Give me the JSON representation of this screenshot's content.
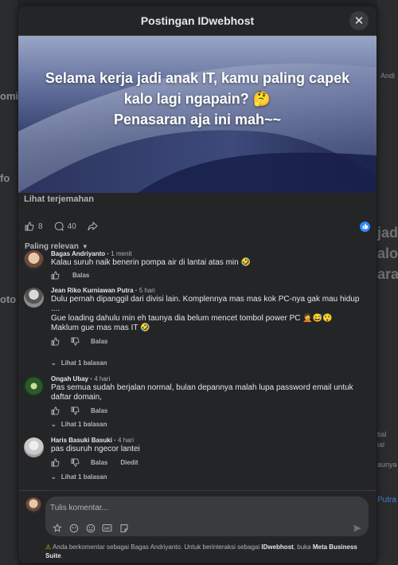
{
  "background": {
    "right_big": [
      "jad",
      "alo",
      "ara"
    ],
    "left_labels": [
      "omi",
      "fo",
      "oto"
    ],
    "right_small": [
      "Andi",
      "tial",
      "ial",
      "aunya",
      "Putra"
    ]
  },
  "post": {
    "header_title": "Postingan IDwebhost",
    "image_text_line1": "Selama kerja jadi anak IT, kamu paling capek",
    "image_text_line2": "kalo lagi ngapain? 🤔",
    "image_text_line3": "Penasaran aja ini mah~~",
    "see_translation": "Lihat terjemahan",
    "like_count": "8",
    "comment_count": "40",
    "sort_label": "Paling relevan"
  },
  "comments": [
    {
      "name": "Bagas Andriyanto",
      "time": "1 menit",
      "text": "Kalau suruh naik benerin pompa air di lantai atas min 🤣",
      "reply_label": "Balas"
    },
    {
      "name": "Jean Riko Kurniawan Putra",
      "time": "5 hari",
      "text1": "Dulu pernah dipanggil dari divisi lain. Komplennya mas mas kok PC-nya gak mau hidup ....",
      "text2": "Gue loading dahulu min eh taunya dia belum mencet tombol power PC 🤦😅😲",
      "text3": "Maklum gue mas mas IT 🤣",
      "reply_label": "Balas",
      "replies_label": "Lihat 1 balasan"
    },
    {
      "name": "Ongah Ubay",
      "time": "4 hari",
      "text": "Pas semua sudah berjalan normal, bulan depannya malah lupa password email untuk daftar domain,",
      "reply_label": "Balas",
      "replies_label": "Lihat 1 balasan"
    },
    {
      "name": "Haris Basuki Basuki",
      "time": "4 hari",
      "text": "pas disuruh ngecor lantei",
      "reply_label": "Balas",
      "edited_label": "Diedit",
      "replies_label": "Lihat 1 balasan"
    }
  ],
  "composer": {
    "placeholder": "Tulis komentar...",
    "notice_prefix": "Anda berkomentar sebagai Bagas Andriyanto. Untuk berinteraksi sebagai",
    "notice_page": "IDwebhost",
    "notice_mid": ", buka",
    "notice_suite": "Meta Business Suite",
    "notice_end": "."
  },
  "colors": {
    "accent": "#2d88ff",
    "surface": "#242526",
    "input": "#3a3b3c",
    "text": "#e4e6eb",
    "muted": "#b0b3b8"
  }
}
